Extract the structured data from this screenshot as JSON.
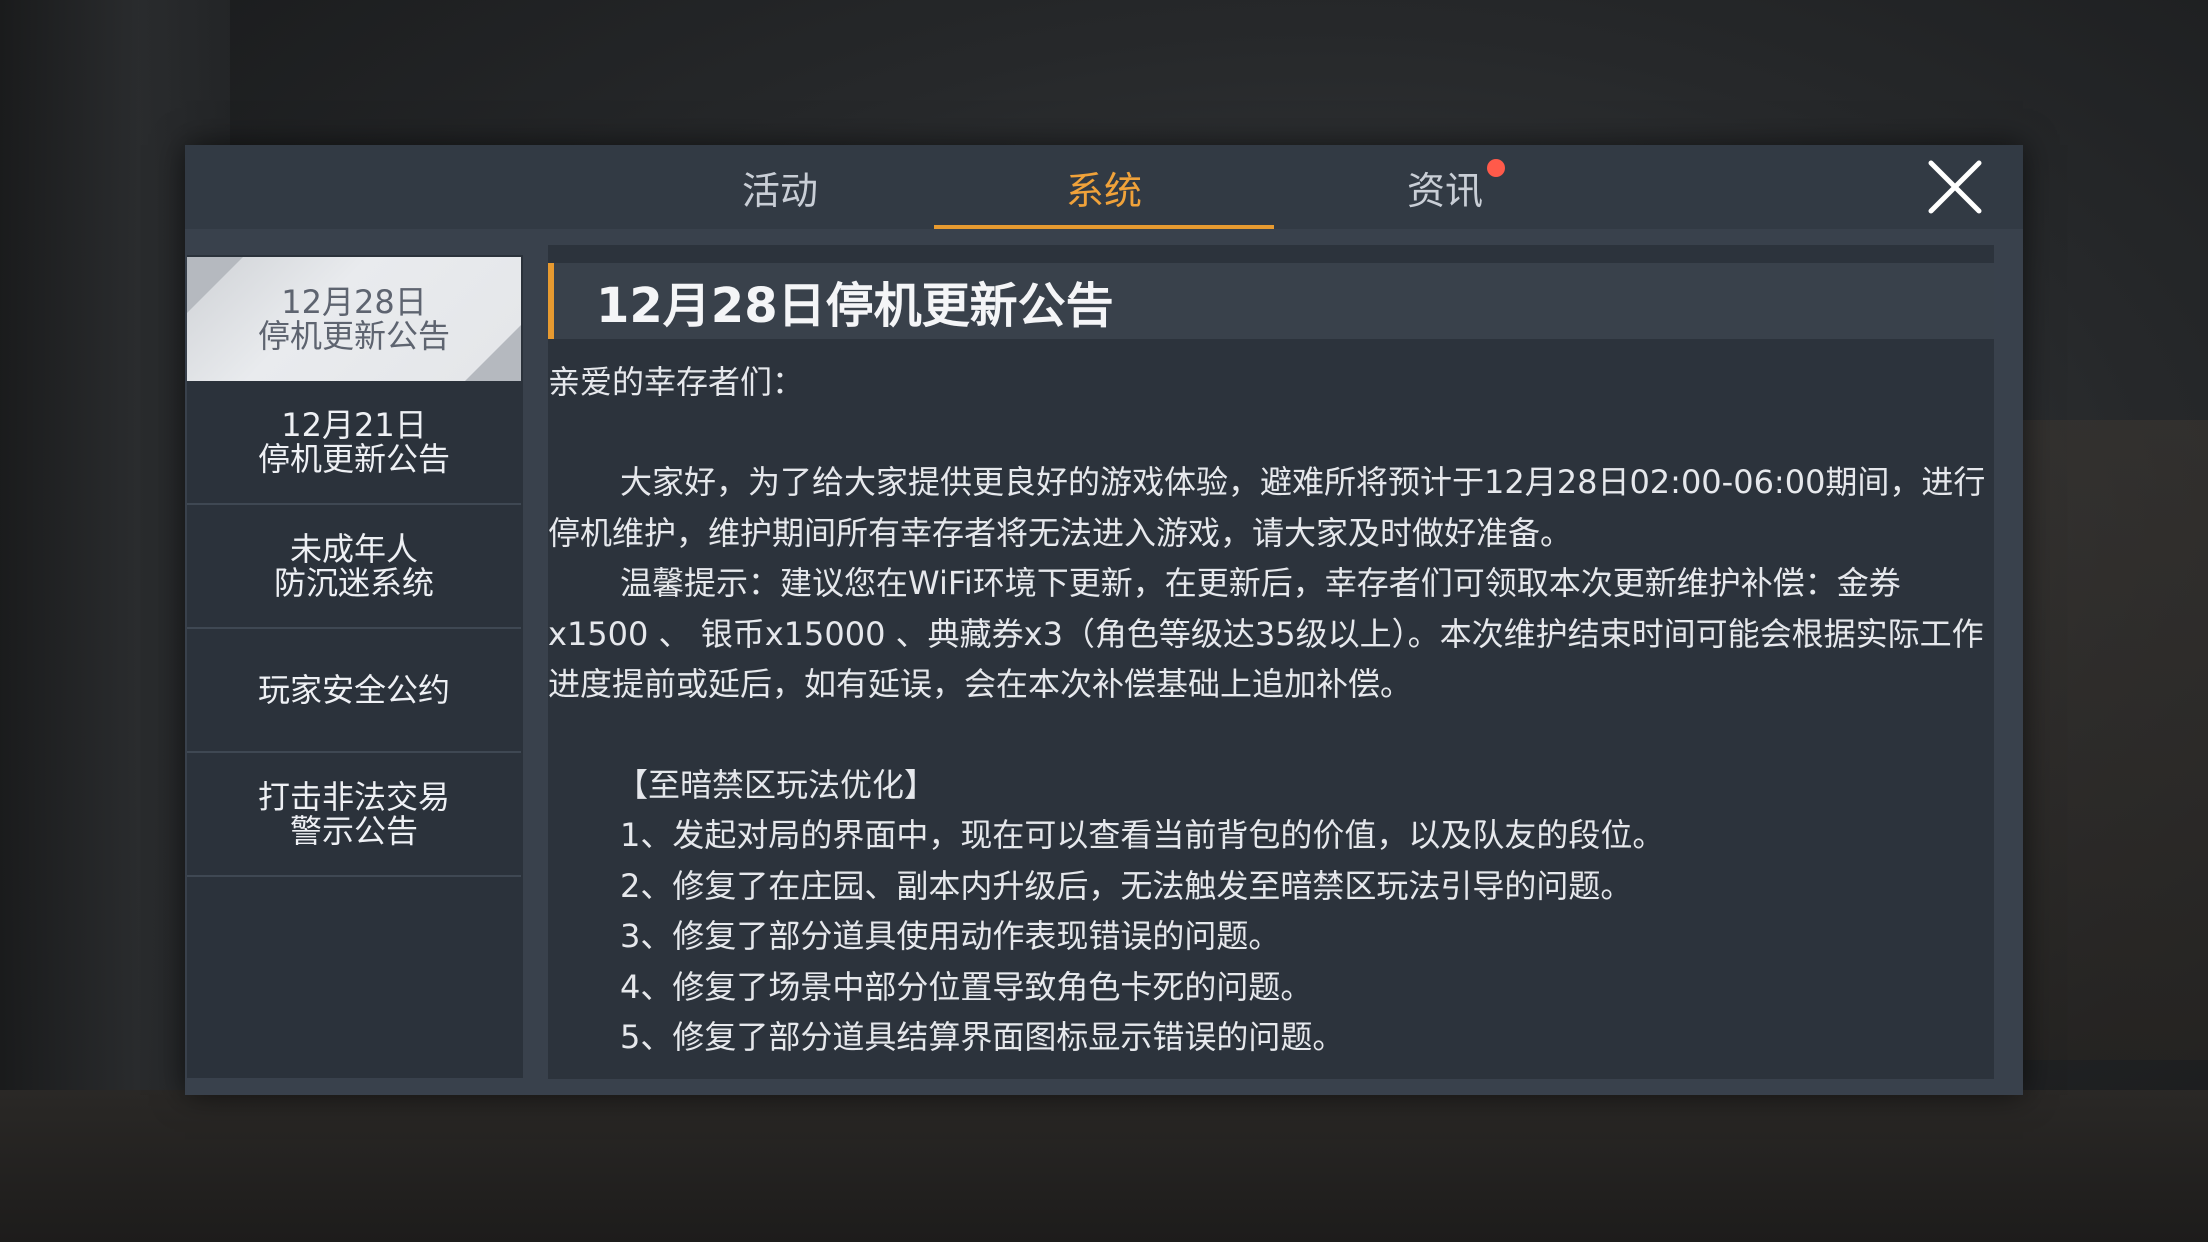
{
  "tabs": [
    {
      "label": "活动"
    },
    {
      "label": "系统"
    },
    {
      "label": "资讯"
    }
  ],
  "sidebar": {
    "items": [
      {
        "label": "12月28日\n停机更新公告"
      },
      {
        "label": "12月21日\n停机更新公告"
      },
      {
        "label": "未成年人\n防沉迷系统"
      },
      {
        "label": "玩家安全公约"
      },
      {
        "label": "打击非法交易\n警示公告"
      }
    ]
  },
  "article": {
    "title": "12月28日停机更新公告",
    "greeting": "亲爱的幸存者们：",
    "para1": "大家好，为了给大家提供更良好的游戏体验，避难所将预计于12月28日02:00-06:00期间，进行停机维护，维护期间所有幸存者将无法进入游戏，请大家及时做好准备。",
    "para2": "温馨提示：建议您在WiFi环境下更新，在更新后，幸存者们可领取本次更新维护补偿：金券x1500 、 银币x15000 、典藏券x3（角色等级达35级以上）。本次维护结束时间可能会根据实际工作进度提前或延后，如有延误，会在本次补偿基础上追加补偿。",
    "section_title": "【至暗禁区玩法优化】",
    "items": [
      "1、发起对局的界面中，现在可以查看当前背包的价值，以及队友的段位。",
      "2、修复了在庄园、副本内升级后，无法触发至暗禁区玩法引导的问题。",
      "3、修复了部分道具使用动作表现错误的问题。",
      "4、修复了场景中部分位置导致角色卡死的问题。",
      "5、修复了部分道具结算界面图标显示错误的问题。"
    ]
  },
  "colors": {
    "accent": "#e79a30",
    "notification_dot": "#ff5a4a",
    "panel": "#39414c",
    "content_bg": "#2c333c"
  },
  "icons": {
    "close": "close-x-icon",
    "notification": "red-dot-badge"
  }
}
